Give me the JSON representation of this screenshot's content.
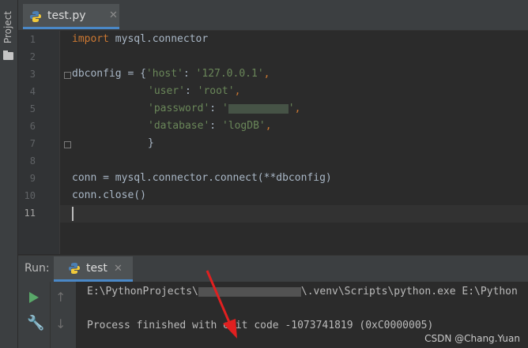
{
  "sidebar": {
    "label": "Project",
    "icon": "folder-icon"
  },
  "editor_tab": {
    "label": "test.py",
    "close": "✕",
    "icon": "python-icon"
  },
  "editor": {
    "line_numbers": [
      "1",
      "2",
      "3",
      "4",
      "5",
      "6",
      "7",
      "8",
      "9",
      "10",
      "11"
    ],
    "current_line": "11",
    "code": {
      "l1_kw": "import",
      "l1_rest": " mysql.connector",
      "l3_a": "dbconfig = {",
      "l3_key": "'host'",
      "l3_colon": ": ",
      "l3_val": "'127.0.0.1'",
      "l3_end": ",",
      "l4_key": "'user'",
      "l4_colon": ": ",
      "l4_val": "'root'",
      "l4_end": ",",
      "l5_key": "'password'",
      "l5_colon": ": ",
      "l5_val_open": "'",
      "l5_val_close": "'",
      "l5_end": ",",
      "l6_key": "'database'",
      "l6_colon": ": ",
      "l6_val": "'logDB'",
      "l6_end": ",",
      "l7": "}",
      "l9": "conn = mysql.connector.connect(**dbconfig)",
      "l10": "conn.close()"
    }
  },
  "run": {
    "label": "Run:",
    "tab_label": "test",
    "tab_close": "✕",
    "output_line1_a": "E:\\PythonProjects\\",
    "output_line1_b": "\\.venv\\Scripts\\python.exe E:\\Python",
    "output_line2": "Process finished with exit code -1073741819 (0xC0000005)"
  },
  "watermark": "CSDN @Chang.Yuan",
  "colors": {
    "keyword": "#cc7832",
    "string": "#6a8759",
    "text": "#a9b7c6",
    "accent": "#4a88c7",
    "run_green": "#59a869"
  }
}
